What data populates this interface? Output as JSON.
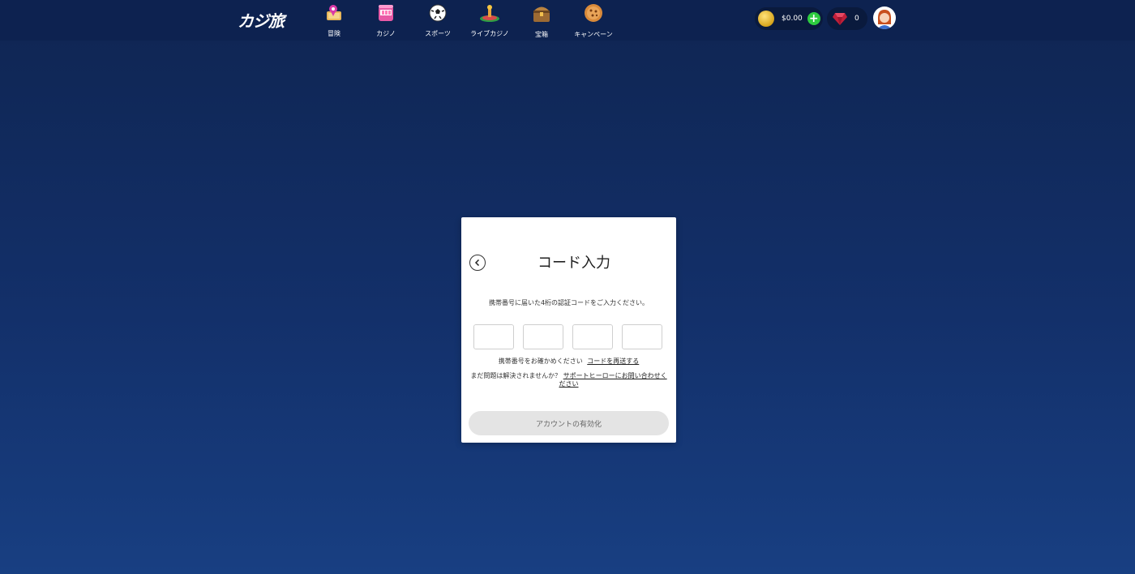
{
  "header": {
    "logo_text": "カジ旅",
    "nav_items": [
      {
        "label": "冒険",
        "icon": "map-pin-icon"
      },
      {
        "label": "カジノ",
        "icon": "slot-machine-icon"
      },
      {
        "label": "スポーツ",
        "icon": "soccer-ball-icon"
      },
      {
        "label": "ライブカジノ",
        "icon": "roulette-icon"
      },
      {
        "label": "宝箱",
        "icon": "treasure-chest-icon"
      },
      {
        "label": "キャンペーン",
        "icon": "cookie-icon"
      }
    ],
    "balance": "$0.00",
    "gems": "0"
  },
  "modal": {
    "title": "コード入力",
    "instruction": "携帯番号に届いた4桁の認証コードをご入力ください。",
    "code_boxes": [
      "",
      "",
      "",
      ""
    ],
    "resend_prefix": "携帯番号をお確かめください",
    "resend_link": "コードを再送する",
    "help_prefix": "まだ問題は解決されませんか？",
    "help_link": "サポートヒーローにお問い合わせください",
    "activate_label": "アカウントの有効化"
  },
  "colors": {
    "background_top": "#0f2552",
    "background_bottom": "#183f82",
    "topbar": "#0d2250",
    "add_button": "#2ecc40",
    "activate_button_bg": "#e4e4e4"
  }
}
